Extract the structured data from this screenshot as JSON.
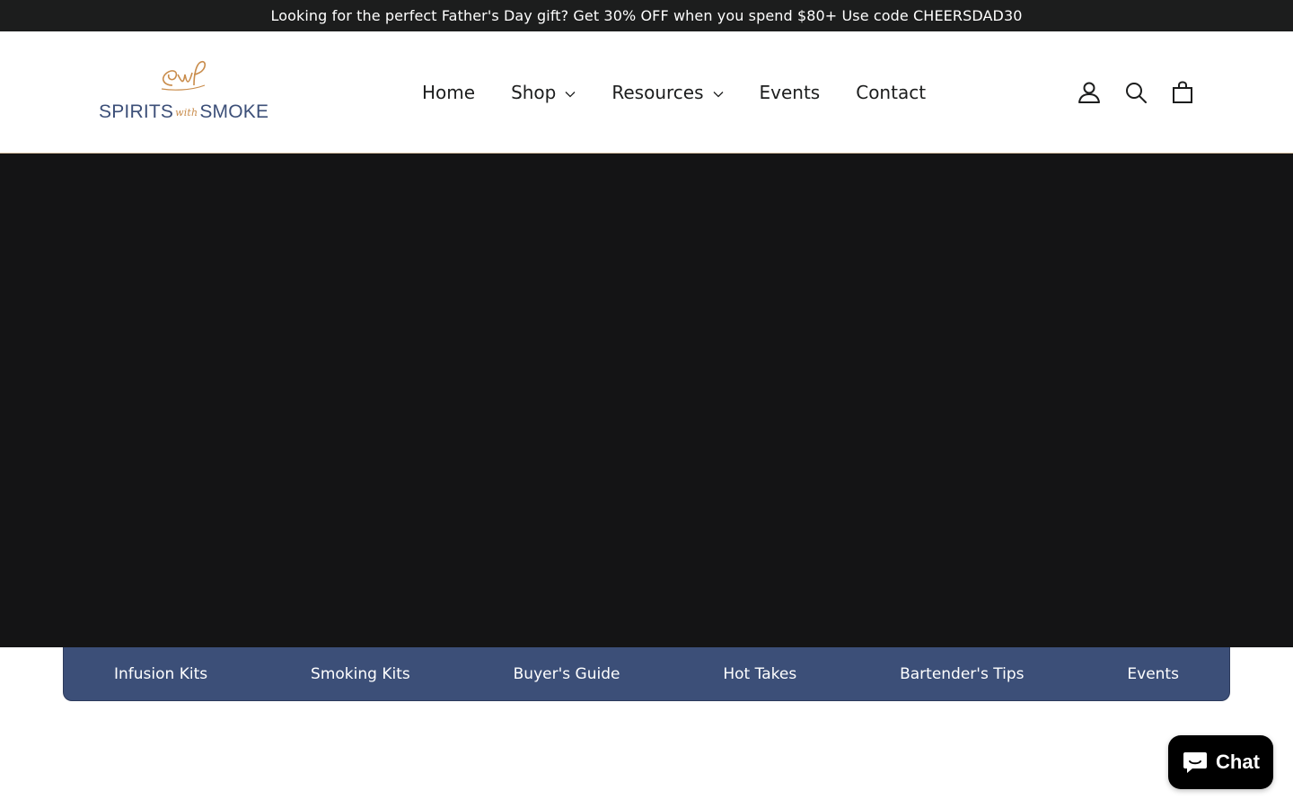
{
  "announcement": {
    "text": "Looking for the perfect Father's Day gift? Get 30% OFF when you spend $80+ Use code CHEERSDAD30"
  },
  "brand": {
    "name_left": "SPIRITS",
    "name_with": "with",
    "name_right": "SMOKE",
    "navy": "#3c4f78",
    "gold": "#c98c4b"
  },
  "nav": {
    "items": [
      {
        "label": "Home",
        "has_dropdown": false
      },
      {
        "label": "Shop",
        "has_dropdown": true
      },
      {
        "label": "Resources",
        "has_dropdown": true
      },
      {
        "label": "Events",
        "has_dropdown": false
      },
      {
        "label": "Contact",
        "has_dropdown": false
      }
    ]
  },
  "header_icons": [
    "account-icon",
    "search-icon",
    "cart-icon"
  ],
  "hero": {
    "background": "#141415"
  },
  "quicklinks": {
    "items": [
      "Infusion Kits",
      "Smoking Kits",
      "Buyer's Guide",
      "Hot Takes",
      "Bartender's Tips",
      "Events"
    ]
  },
  "chat": {
    "label": "Chat"
  }
}
